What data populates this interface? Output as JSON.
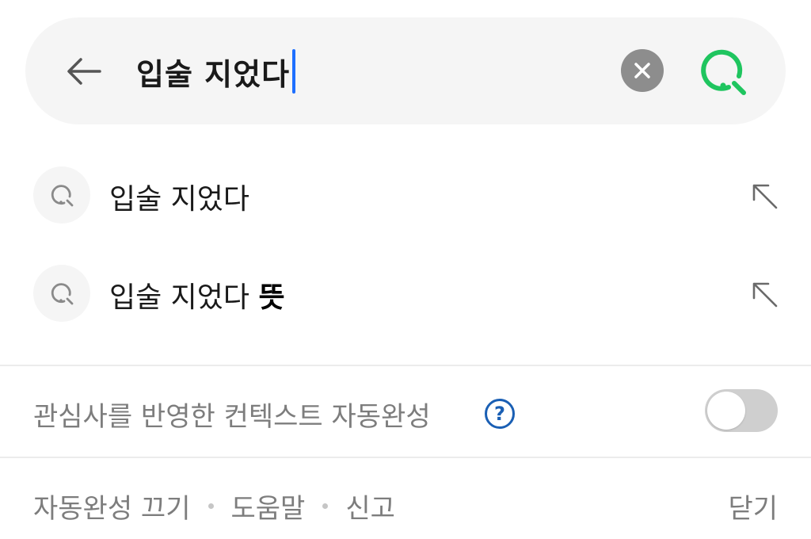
{
  "search": {
    "query": "입술 지었다",
    "icons": {
      "back": "back-arrow-icon",
      "clear": "clear-x-icon",
      "search": "search-magnifier-icon"
    },
    "colors": {
      "caret": "#1e6fff",
      "search_icon": "#1fc55f",
      "clear_bg": "#8d8d8d"
    }
  },
  "suggestions": [
    {
      "text": "입술 지었다",
      "bold_suffix": ""
    },
    {
      "text": "입술 지었다 ",
      "bold_suffix": "뜻"
    }
  ],
  "context_autocomplete": {
    "label": "관심사를 반영한 컨텍스트 자동완성",
    "help": "?",
    "enabled": false
  },
  "footer": {
    "links": [
      "자동완성 끄기",
      "도움말",
      "신고"
    ],
    "close": "닫기"
  }
}
